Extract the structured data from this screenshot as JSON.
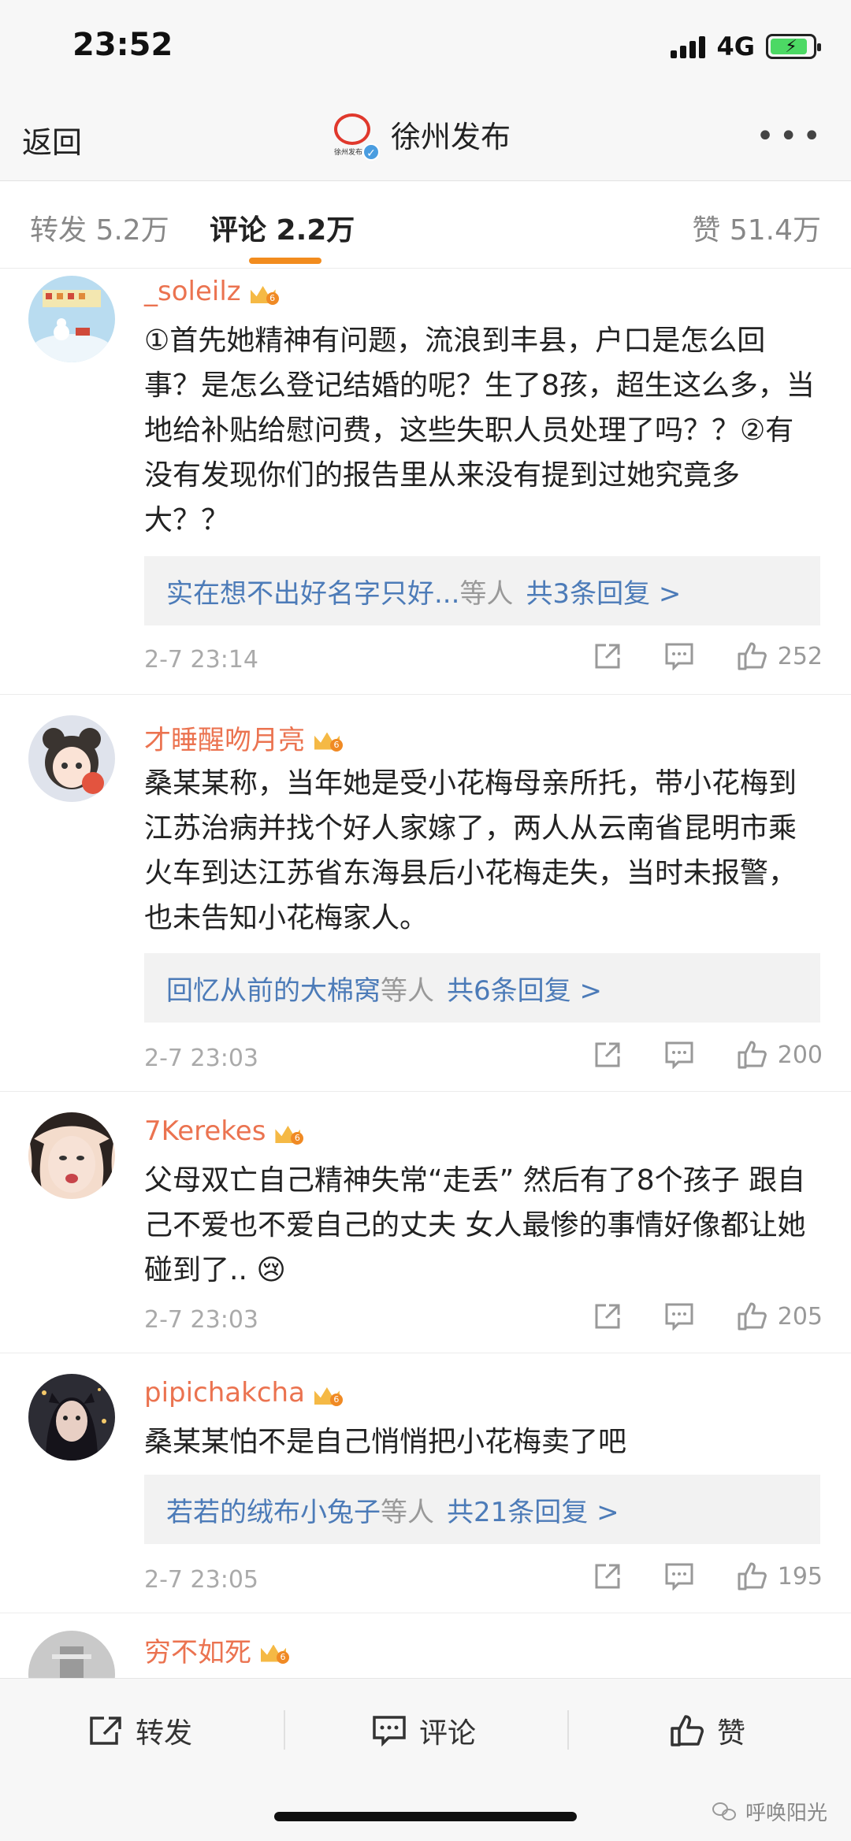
{
  "status": {
    "time": "23:52",
    "network": "4G"
  },
  "nav": {
    "back": "返回",
    "title": "徐州发布",
    "logo_text": "徐州发布",
    "more": "•••"
  },
  "tabs": {
    "repost": "转发 5.2万",
    "comments": "评论 2.2万",
    "likes": "赞 51.4万"
  },
  "comments": [
    {
      "user": "_soleilz",
      "text": "①首先她精神有问题，流浪到丰县，户口是怎么回事？是怎么登记结婚的呢？生了8孩，超生这么多，当地给补贴给慰问费，这些失职人员处理了吗？？②有没有发现你们的报告里从来没有提到过她究竟多大？？",
      "reply_user": "实在想不出好名字只好...",
      "reply_mid": "等人",
      "reply_count": "共3条回复 >",
      "time": "2-7 23:14",
      "likes": "252"
    },
    {
      "user": "才睡醒吻月亮",
      "text": "桑某某称，当年她是受小花梅母亲所托，带小花梅到江苏治病并找个好人家嫁了，两人从云南省昆明市乘火车到达江苏省东海县后小花梅走失，当时未报警，也未告知小花梅家人。",
      "reply_user": "回忆从前的大棉窝",
      "reply_mid": "等人",
      "reply_count": "共6条回复 >",
      "time": "2-7 23:03",
      "likes": "200"
    },
    {
      "user": "7Kerekes",
      "text": "父母双亡自己精神失常“走丢” 然后有了8个孩子 跟自己不爱也不爱自己的丈夫 女人最惨的事情好像都让她碰到了.. 😢",
      "time": "2-7 23:03",
      "likes": "205"
    },
    {
      "user": "pipichakcha",
      "text": "桑某某怕不是自己悄悄把小花梅卖了吧",
      "reply_user": "若若的绒布小兔子",
      "reply_mid": "等人",
      "reply_count": "共21条回复 >",
      "time": "2-7 23:05",
      "likes": "195"
    },
    {
      "user": "穷不如死"
    }
  ],
  "bottom": {
    "repost": "转发",
    "comment": "评论",
    "like": "赞"
  },
  "watermark": "呼唤阳光",
  "colors": {
    "username": "#eb7350",
    "reply_link": "#4c7bb8",
    "tab_indicator": "#f28c1e",
    "battery": "#4cd964"
  }
}
